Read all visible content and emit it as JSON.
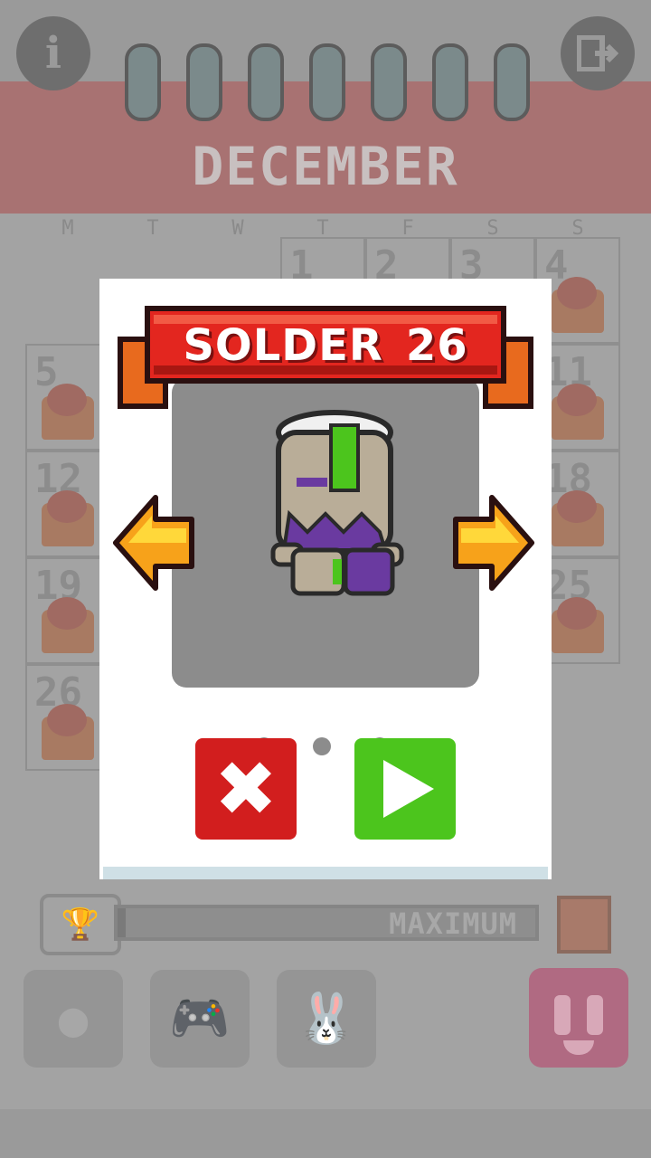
{
  "calendar": {
    "month": "DECEMBER",
    "weekdays": [
      "M",
      "T",
      "W",
      "T",
      "F",
      "S",
      "S"
    ],
    "week1": [
      "1",
      "2",
      "3",
      "4"
    ],
    "visible_days_left": [
      "5",
      "12",
      "19",
      "26"
    ],
    "visible_days_right": [
      "11",
      "18",
      "25"
    ]
  },
  "top_bar": {
    "info_icon": "i",
    "exit_icon": "exit-icon"
  },
  "progress": {
    "label": "MAXIMUM",
    "fill_fraction": 0.02
  },
  "modal": {
    "level_name": "SOLDER_26",
    "photos_collected": 3,
    "close_icon": "✖",
    "play_icon": "play-icon"
  },
  "colors": {
    "banner_red": "#e3261f",
    "close_red": "#d21e1e",
    "play_green": "#4cc51d",
    "arrow_orange": "#f7a21a"
  }
}
